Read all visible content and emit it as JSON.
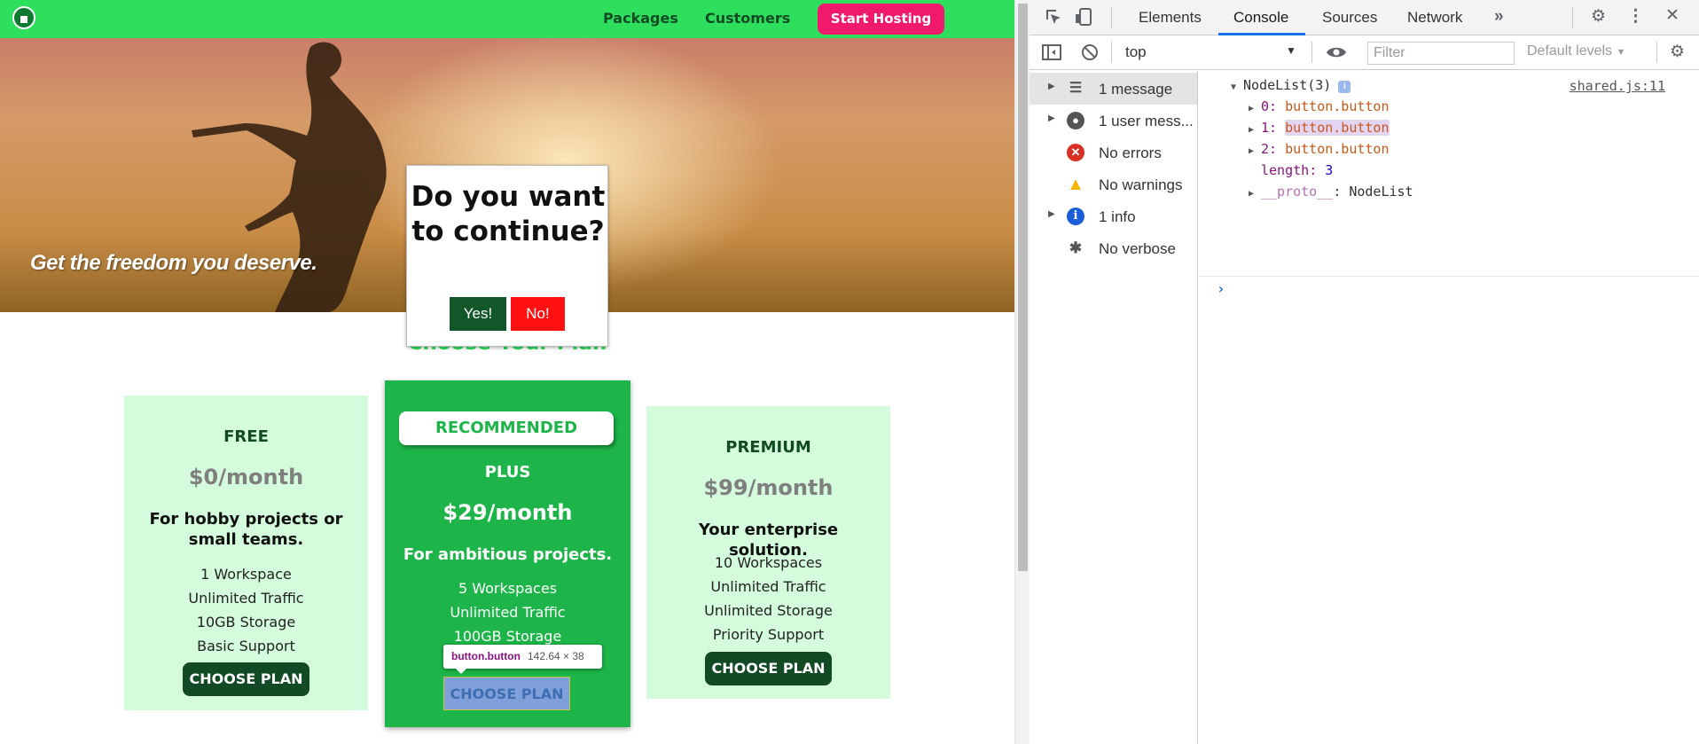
{
  "nav": {
    "links": [
      "Packages",
      "Customers"
    ],
    "cta": "Start Hosting"
  },
  "hero": {
    "tagline": "Get the freedom you deserve."
  },
  "modal": {
    "question": "Do you want to continue?",
    "yes": "Yes!",
    "no": "No!"
  },
  "section_title": "Choose Your Plan",
  "plans": [
    {
      "name": "FREE",
      "price": "$0/month",
      "desc": "For hobby projects or small teams.",
      "features": [
        "1 Workspace",
        "Unlimited Traffic",
        "10GB Storage",
        "Basic Support"
      ],
      "button": "CHOOSE PLAN"
    },
    {
      "badge": "RECOMMENDED",
      "name": "PLUS",
      "price": "$29/month",
      "desc": "For ambitious projects.",
      "features": [
        "5 Workspaces",
        "Unlimited Traffic",
        "100GB Storage"
      ],
      "button": "CHOOSE PLAN"
    },
    {
      "name": "PREMIUM",
      "price": "$99/month",
      "desc": "Your enterprise solution.",
      "features": [
        "10 Workspaces",
        "Unlimited Traffic",
        "Unlimited Storage",
        "Priority Support"
      ],
      "button": "CHOOSE PLAN"
    }
  ],
  "tooltip": {
    "selector": "button.button",
    "size": "142.64 × 38"
  },
  "devtools": {
    "tabs": [
      "Elements",
      "Console",
      "Sources",
      "Network"
    ],
    "active_tab": "Console",
    "context": "top",
    "filter_placeholder": "Filter",
    "levels": "Default levels",
    "sidebar": [
      {
        "label": "1 message",
        "icon": "list-icon"
      },
      {
        "label": "1 user mess...",
        "icon": "user-icon"
      },
      {
        "label": "No errors",
        "icon": "error-icon"
      },
      {
        "label": "No warnings",
        "icon": "warning-icon"
      },
      {
        "label": "1 info",
        "icon": "info-icon"
      },
      {
        "label": "No verbose",
        "icon": "bug-icon"
      }
    ],
    "console": {
      "header": "NodeList(3)",
      "source": "shared.js:11",
      "items": [
        {
          "key": "0",
          "value": "button.button"
        },
        {
          "key": "1",
          "value": "button.button"
        },
        {
          "key": "2",
          "value": "button.button"
        }
      ],
      "length_key": "length",
      "length_value": "3",
      "proto_key": "__proto__",
      "proto_value": "NodeList"
    }
  },
  "colors": {
    "nav_green": "#2ddf5c",
    "dark_green": "#114a25",
    "plus_green": "#1db549",
    "light_card": "#d4fbdc",
    "cta_pink": "#f0196b",
    "no_red": "#ff1111",
    "devtools_accent": "#1a73e8"
  }
}
